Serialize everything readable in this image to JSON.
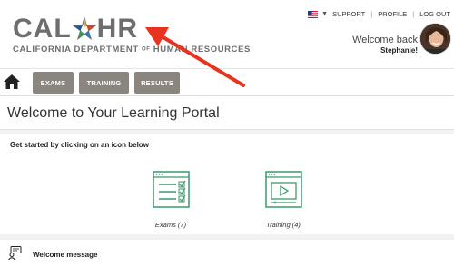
{
  "logo": {
    "main_left": "CAL",
    "main_right": "HR",
    "subtitle_left": "CALIFORNIA DEPARTMENT ",
    "subtitle_of": "OF",
    "subtitle_right": " HUMAN RESOURCES"
  },
  "topnav": {
    "flag": "us-flag-icon",
    "support": "SUPPORT",
    "profile": "PROFILE",
    "logout": "LOG OUT"
  },
  "user": {
    "welcome": "Welcome back",
    "name": "Stephanie!"
  },
  "navbar": {
    "home_icon": "home-icon",
    "items": [
      {
        "label": "EXAMS"
      },
      {
        "label": "TRAINING"
      },
      {
        "label": "RESULTS"
      }
    ]
  },
  "page": {
    "title": "Welcome to Your Learning Portal"
  },
  "panel": {
    "prompt": "Get started by clicking on an icon below",
    "cards": [
      {
        "label": "Exams (7)",
        "icon": "checklist-icon"
      },
      {
        "label": "Training (4)",
        "icon": "video-player-icon"
      }
    ]
  },
  "message": {
    "label": "Welcome message",
    "icon": "chat-person-icon"
  },
  "colors": {
    "accent_green": "#3a9a6a",
    "nav_button": "#8b857f",
    "annotation_arrow": "#e8331f"
  }
}
